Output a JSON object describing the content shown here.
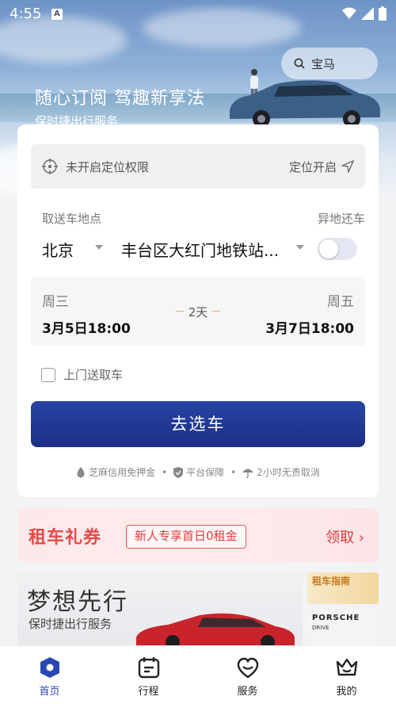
{
  "status_bar": {
    "time": "4:55",
    "notif_glyph": "A"
  },
  "search": {
    "placeholder": "宝马"
  },
  "hero": {
    "slogan": "随心订阅  驾趣新享法",
    "sub": "保时捷出行服务"
  },
  "location": {
    "status": "未开启定位权限",
    "action": "定位开启"
  },
  "pickup": {
    "label": "取送车地点",
    "city": "北京",
    "address": "丰台区大红门地铁站...",
    "diff_return_label": "异地还车",
    "diff_return_on": false
  },
  "dates": {
    "start_weekday": "周三",
    "start": "3月5日18:00",
    "end_weekday": "周五",
    "end": "3月7日18:00",
    "duration": "2天"
  },
  "door_service": {
    "label": "上门送取车",
    "checked": false
  },
  "cta": {
    "label": "去选车"
  },
  "guarantees": [
    "芝麻信用免押金",
    "平台保障",
    "2小时无责取消"
  ],
  "coupon": {
    "title": "租车礼券",
    "tag": "新人专享首日0租金",
    "claim": "领取 ›"
  },
  "banner": {
    "title": "梦想先行",
    "sub": "保时捷出行服务",
    "thumb1_text": "租车指南",
    "thumb2_brand": "PORSCHE",
    "thumb2_sub": "DRIVE"
  },
  "tabs": [
    {
      "label": "首页",
      "active": true
    },
    {
      "label": "行程",
      "active": false
    },
    {
      "label": "服务",
      "active": false
    },
    {
      "label": "我的",
      "active": false
    }
  ],
  "colors": {
    "primary": "#1f368f",
    "accent_red": "#e23c3c",
    "active_tab": "#2747b1"
  }
}
